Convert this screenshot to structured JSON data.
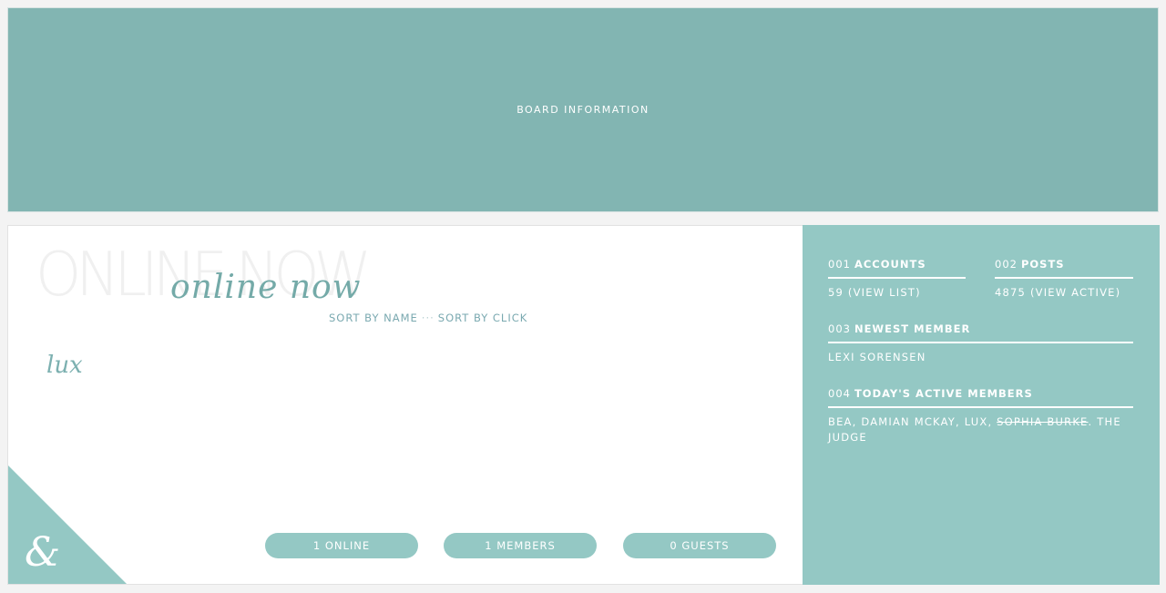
{
  "board": {
    "title": "BOARD INFORMATION"
  },
  "online": {
    "ghost_title": "ONLINE NOW",
    "script_title": "online now",
    "sort_by_name": "SORT BY NAME",
    "sort_separator": "···",
    "sort_by_click": "SORT BY CLICK",
    "users": [
      "lux"
    ],
    "corner_glyph": "&",
    "counts": {
      "online": "1 ONLINE",
      "members": "1 MEMBERS",
      "guests": "0 GUESTS"
    }
  },
  "stats": {
    "accounts": {
      "num": "001",
      "label": "ACCOUNTS",
      "value": "59",
      "link": "(VIEW LIST)"
    },
    "posts": {
      "num": "002",
      "label": "POSTS",
      "value": "4875",
      "link": "(VIEW ACTIVE)"
    },
    "newest": {
      "num": "003",
      "label": "NEWEST MEMBER",
      "value": "LEXI SORENSEN"
    },
    "active": {
      "num": "004",
      "label": "TODAY'S ACTIVE MEMBERS",
      "members": [
        "BEA",
        "DAMIAN MCKAY",
        "LUX",
        "SOPHIA BURKE",
        "THE JUDGE"
      ],
      "sep": ", ",
      "trailing_sep": ". "
    }
  },
  "colors": {
    "board_bg": "#82b5b2",
    "accent": "#94c8c4",
    "script_text": "#74aaa8",
    "sort_text": "#7aa9b0"
  }
}
